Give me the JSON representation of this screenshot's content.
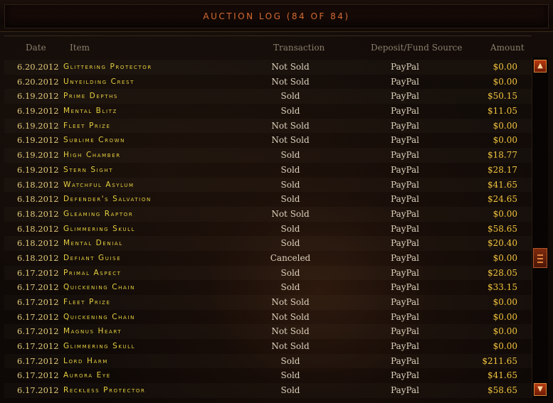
{
  "title": "AUCTION LOG (84 OF 84)",
  "columns": {
    "date": "Date",
    "item": "Item",
    "transaction": "Transaction",
    "source": "Deposit/Fund Source",
    "amount": "Amount"
  },
  "rows": [
    {
      "date": "6.20.2012",
      "item": "Glittering Protector",
      "transaction": "Not Sold",
      "source": "PayPal",
      "amount": "$0.00"
    },
    {
      "date": "6.20.2012",
      "item": "Unyeilding Crest",
      "transaction": "Not Sold",
      "source": "PayPal",
      "amount": "$0.00"
    },
    {
      "date": "6.19.2012",
      "item": "Prime Depths",
      "transaction": "Sold",
      "source": "PayPal",
      "amount": "$50.15"
    },
    {
      "date": "6.19.2012",
      "item": "Mental Blitz",
      "transaction": "Sold",
      "source": "PayPal",
      "amount": "$11.05"
    },
    {
      "date": "6.19.2012",
      "item": "Fleet Prize",
      "transaction": "Not Sold",
      "source": "PayPal",
      "amount": "$0.00"
    },
    {
      "date": "6.19.2012",
      "item": "Sublime Crown",
      "transaction": "Not Sold",
      "source": "PayPal",
      "amount": "$0.00"
    },
    {
      "date": "6.19.2012",
      "item": "High Chamber",
      "transaction": "Sold",
      "source": "PayPal",
      "amount": "$18.77"
    },
    {
      "date": "6.19.2012",
      "item": "Stern Sight",
      "transaction": "Sold",
      "source": "PayPal",
      "amount": "$28.17"
    },
    {
      "date": "6.18.2012",
      "item": "Watchful Asylum",
      "transaction": "Sold",
      "source": "PayPal",
      "amount": "$41.65"
    },
    {
      "date": "6.18.2012",
      "item": "Defender's Salvation",
      "transaction": "Sold",
      "source": "PayPal",
      "amount": "$24.65"
    },
    {
      "date": "6.18.2012",
      "item": "Gleaming Raptor",
      "transaction": "Not Sold",
      "source": "PayPal",
      "amount": "$0.00"
    },
    {
      "date": "6.18.2012",
      "item": "Glimmering Skull",
      "transaction": "Sold",
      "source": "PayPal",
      "amount": "$58.65"
    },
    {
      "date": "6.18.2012",
      "item": "Mental Denial",
      "transaction": "Sold",
      "source": "PayPal",
      "amount": "$20.40"
    },
    {
      "date": "6.18.2012",
      "item": "Defiant Guise",
      "transaction": "Canceled",
      "source": "PayPal",
      "amount": "$0.00"
    },
    {
      "date": "6.17.2012",
      "item": "Primal Aspect",
      "transaction": "Sold",
      "source": "PayPal",
      "amount": "$28.05"
    },
    {
      "date": "6.17.2012",
      "item": "Quickening Chain",
      "transaction": "Sold",
      "source": "PayPal",
      "amount": "$33.15"
    },
    {
      "date": "6.17.2012",
      "item": "Fleet Prize",
      "transaction": "Not Sold",
      "source": "PayPal",
      "amount": "$0.00"
    },
    {
      "date": "6.17.2012",
      "item": "Quickening Chain",
      "transaction": "Not Sold",
      "source": "PayPal",
      "amount": "$0.00"
    },
    {
      "date": "6.17.2012",
      "item": "Magnus Heart",
      "transaction": "Not Sold",
      "source": "PayPal",
      "amount": "$0.00"
    },
    {
      "date": "6.17.2012",
      "item": "Glimmering Skull",
      "transaction": "Not Sold",
      "source": "PayPal",
      "amount": "$0.00"
    },
    {
      "date": "6.17.2012",
      "item": "Lord Harm",
      "transaction": "Sold",
      "source": "PayPal",
      "amount": "$211.65"
    },
    {
      "date": "6.17.2012",
      "item": "Aurora Eye",
      "transaction": "Sold",
      "source": "PayPal",
      "amount": "$41.65"
    },
    {
      "date": "6.17.2012",
      "item": "Reckless Protector",
      "transaction": "Sold",
      "source": "PayPal",
      "amount": "$58.65"
    }
  ],
  "scrollbar": {
    "up_icon": "▲",
    "down_icon": "▼"
  },
  "colors": {
    "title": "#d46a32",
    "item_name": "#e6d040",
    "amount": "#f1c33f",
    "scroll_button": "#b83a12"
  }
}
